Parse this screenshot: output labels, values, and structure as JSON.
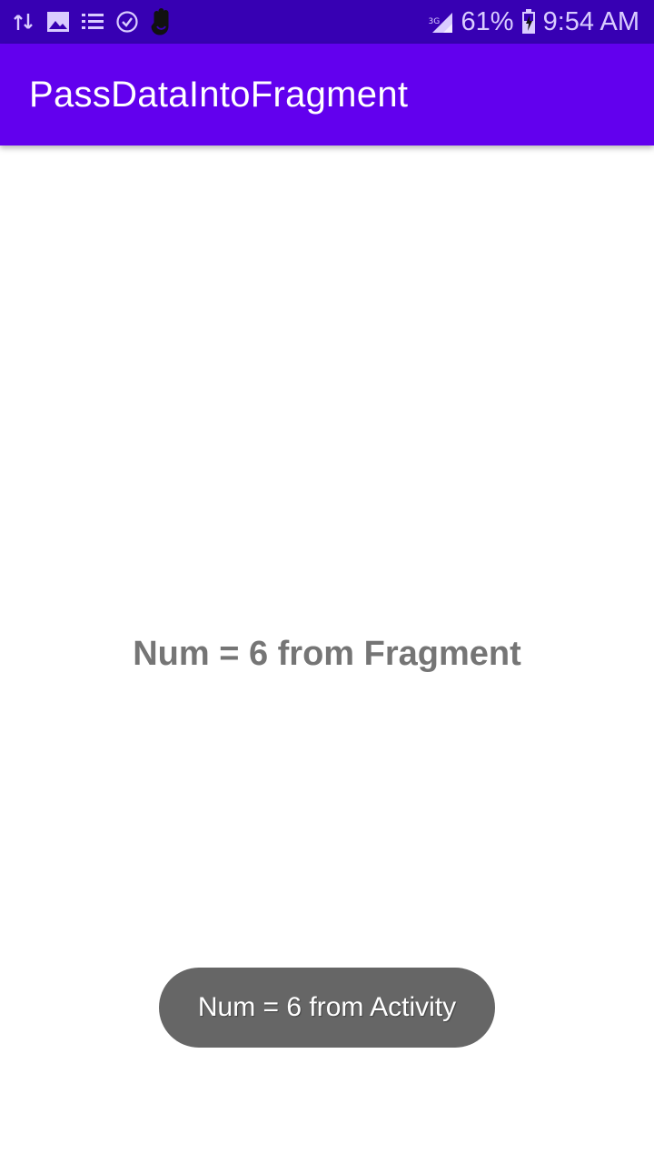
{
  "status_bar": {
    "left_icons": [
      "data-transfer-icon",
      "image-icon",
      "list-icon",
      "check-circle-icon",
      "hand-icon"
    ],
    "network_label": "3G",
    "battery": "61%",
    "time": "9:54 AM",
    "colors": {
      "background": "#3700b3",
      "text": "#d9ccff"
    }
  },
  "app_bar": {
    "title": "PassDataIntoFragment",
    "color": "#6200ee"
  },
  "content": {
    "fragment_text": "Num = 6 from Fragment"
  },
  "toast": {
    "text": "Num = 6 from Activity"
  }
}
